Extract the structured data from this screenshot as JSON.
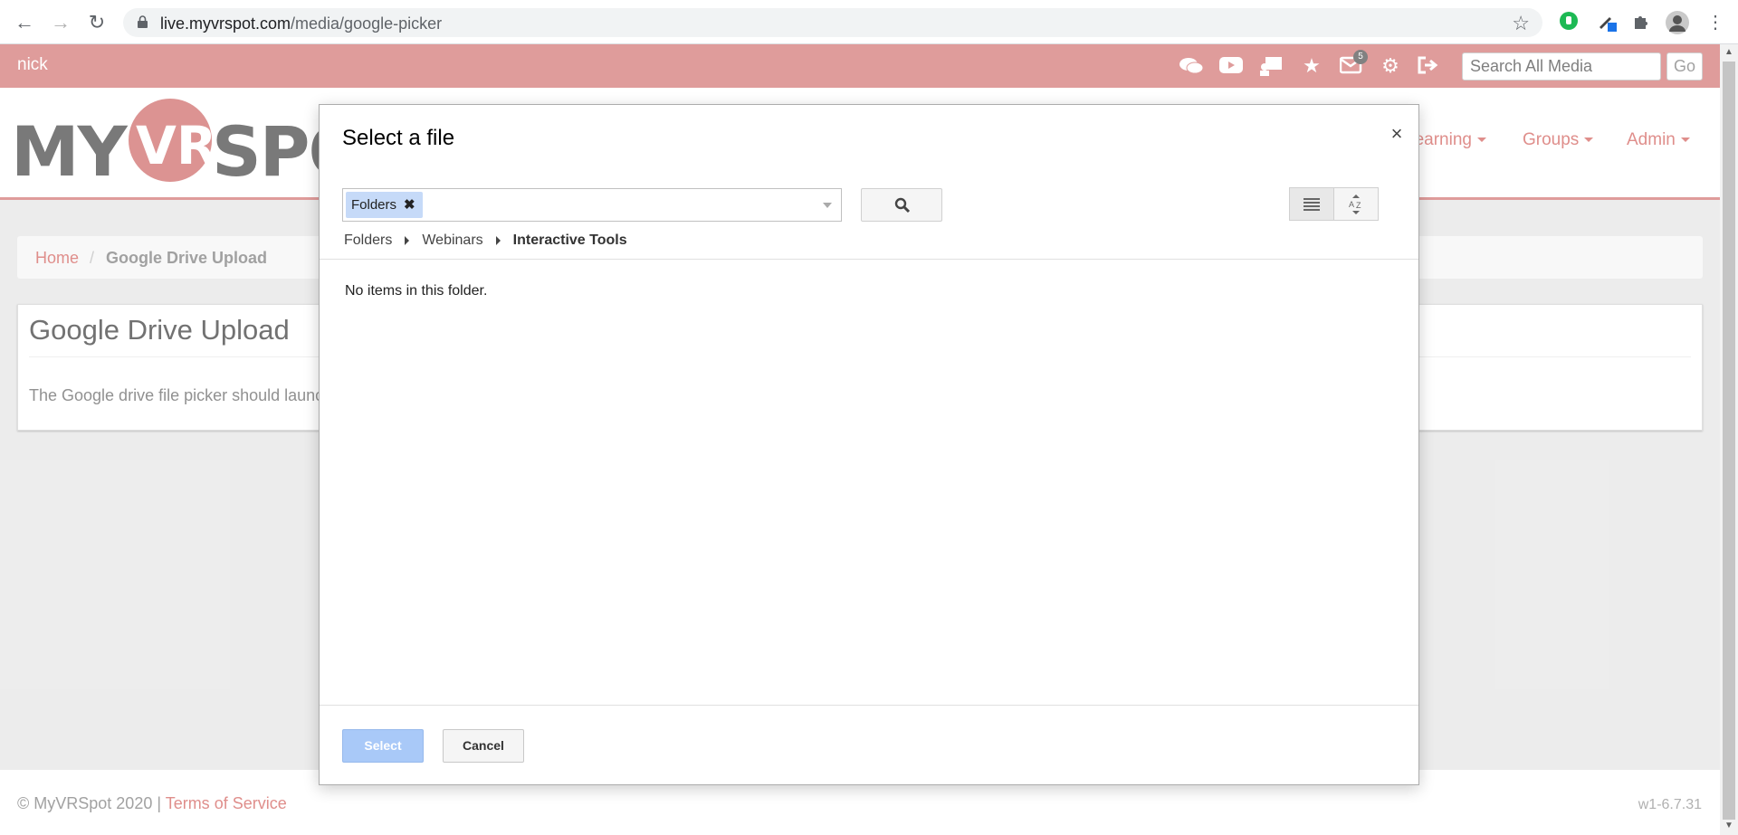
{
  "browser": {
    "url_host": "live.myvrspot.com",
    "url_path": "/media/google-picker"
  },
  "topbar": {
    "username": "nick",
    "mail_count": "5",
    "search_placeholder": "Search All Media",
    "go_label": "Go",
    "bar_color": "#dd9493"
  },
  "header": {
    "logo_my": "MY",
    "logo_vr": "VR",
    "logo_spot": "SPO",
    "nav": [
      {
        "label": "Learning"
      },
      {
        "label": "Groups"
      },
      {
        "label": "Admin"
      }
    ]
  },
  "breadcrumb": {
    "home": "Home",
    "separator": "/",
    "current": "Google Drive Upload"
  },
  "main": {
    "title": "Google Drive Upload",
    "text": "The Google drive file picker should launch"
  },
  "footer": {
    "copyright": "© MyVRSpot 2020 | ",
    "terms": "Terms of Service",
    "version": "w1-6.7.31"
  },
  "dialog": {
    "title": "Select a file",
    "close": "×",
    "chip_label": "Folders",
    "chip_remove": "✖",
    "trail": [
      "Folders",
      "Webinars",
      "Interactive Tools"
    ],
    "empty_message": "No items in this folder.",
    "select_label": "Select",
    "cancel_label": "Cancel"
  }
}
